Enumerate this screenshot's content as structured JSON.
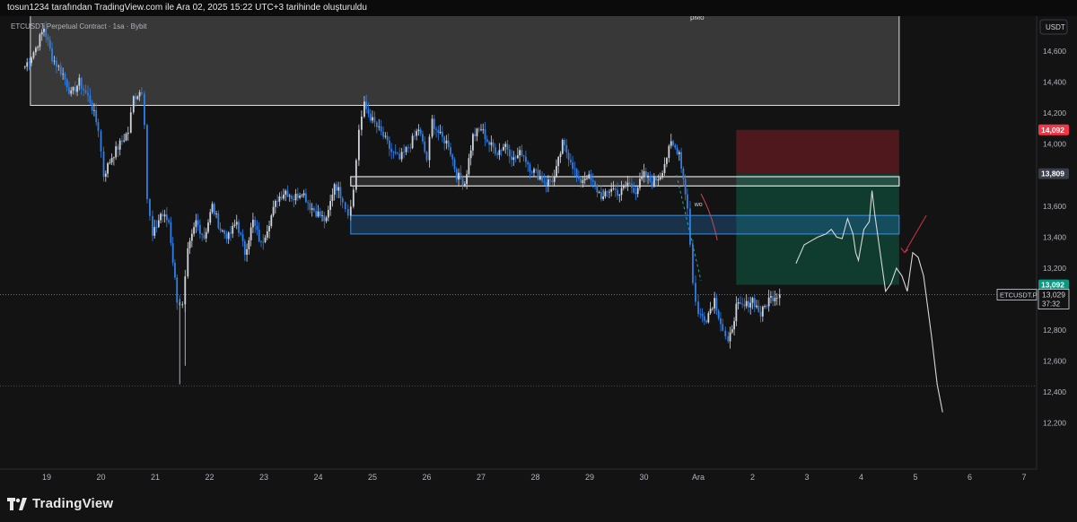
{
  "header": {
    "caption": "tosun1234 tarafından TradingView.com ile Ara 02, 2025 15:22 UTC+3 tarihinde oluşturuldu"
  },
  "footer": {
    "brand": "TradingView"
  },
  "chart_data": {
    "type": "candlestick",
    "symbol_line": "ETCUSDT Perpetual Contract · 1sa · Bybit",
    "currency": "USDT",
    "top_label": "pMo",
    "ylim": [
      12100,
      14870
    ],
    "y_ticks": [
      "14,600",
      "14,400",
      "14,200",
      "14,000",
      "13,800",
      "13,600",
      "13,400",
      "13,200",
      "12,800",
      "12,600",
      "12,400",
      "12,200"
    ],
    "x_ticks": [
      "19",
      "20",
      "21",
      "22",
      "23",
      "24",
      "25",
      "26",
      "27",
      "28",
      "29",
      "30",
      "Ara",
      "2",
      "3",
      "4",
      "5",
      "6",
      "7"
    ],
    "price_badges": [
      {
        "text": "14,092",
        "value": 14092,
        "color": "#f23645"
      },
      {
        "text": "13,809",
        "value": 13809,
        "color": "#3a3e4a"
      },
      {
        "text": "13,092",
        "value": 13092,
        "color": "#089981"
      }
    ],
    "last_price": {
      "symbol": "ETCUSDT.P",
      "price": "13,029",
      "countdown": "37:32",
      "value": 13029
    },
    "annotations": {
      "wo_label": "wo"
    },
    "colors": {
      "up": "#cfd3dc",
      "down": "#2f7fe6",
      "background": "#131313"
    },
    "zones": [
      {
        "name": "supply-zone",
        "x_from": "18.7",
        "x_to": "Ara 3.7",
        "y_low": 14250,
        "y_high": 14830
      },
      {
        "name": "stop-zone",
        "x_from": "Ara 0.7",
        "x_to": "Ara 3.7",
        "y_low": 13809,
        "y_high": 14092
      },
      {
        "name": "target-zone",
        "x_from": "Ara 0.7",
        "x_to": "Ara 3.7",
        "y_low": 13092,
        "y_high": 13809
      },
      {
        "name": "demand-zone",
        "x_from": "24.6",
        "x_to": "Ara 3.7",
        "y_low": 13420,
        "y_high": 13540
      },
      {
        "name": "level-box",
        "x_from": "24.6",
        "x_to": "Ara 3.7",
        "y_low": 13730,
        "y_high": 13790
      }
    ],
    "candle_path": [
      [
        18.6,
        14500
      ],
      [
        18.8,
        14620
      ],
      [
        18.95,
        14750
      ],
      [
        19.1,
        14560
      ],
      [
        19.3,
        14450
      ],
      [
        19.45,
        14320
      ],
      [
        19.6,
        14400
      ],
      [
        19.8,
        14280
      ],
      [
        19.95,
        14100
      ],
      [
        20.05,
        13800
      ],
      [
        20.2,
        13920
      ],
      [
        20.35,
        14000
      ],
      [
        20.5,
        14080
      ],
      [
        20.6,
        14300
      ],
      [
        20.75,
        14350
      ],
      [
        20.8,
        14150
      ],
      [
        20.85,
        13650
      ],
      [
        20.95,
        13400
      ],
      [
        21.1,
        13550
      ],
      [
        21.25,
        13500
      ],
      [
        21.4,
        13000
      ],
      [
        21.5,
        12950
      ],
      [
        21.6,
        13300
      ],
      [
        21.75,
        13500
      ],
      [
        21.9,
        13400
      ],
      [
        22.05,
        13600
      ],
      [
        22.2,
        13450
      ],
      [
        22.35,
        13400
      ],
      [
        22.5,
        13500
      ],
      [
        22.65,
        13300
      ],
      [
        22.8,
        13500
      ],
      [
        22.95,
        13350
      ],
      [
        23.1,
        13500
      ],
      [
        23.25,
        13650
      ],
      [
        23.4,
        13700
      ],
      [
        23.55,
        13650
      ],
      [
        23.7,
        13700
      ],
      [
        23.85,
        13600
      ],
      [
        24.0,
        13550
      ],
      [
        24.15,
        13500
      ],
      [
        24.3,
        13750
      ],
      [
        24.45,
        13650
      ],
      [
        24.55,
        13550
      ],
      [
        24.65,
        13700
      ],
      [
        24.75,
        14100
      ],
      [
        24.85,
        14250
      ],
      [
        25.0,
        14150
      ],
      [
        25.2,
        14050
      ],
      [
        25.35,
        13950
      ],
      [
        25.5,
        13900
      ],
      [
        25.7,
        14000
      ],
      [
        25.85,
        14100
      ],
      [
        26.0,
        13900
      ],
      [
        26.1,
        14150
      ],
      [
        26.25,
        14050
      ],
      [
        26.4,
        14000
      ],
      [
        26.55,
        13800
      ],
      [
        26.7,
        13750
      ],
      [
        26.85,
        14050
      ],
      [
        27.0,
        14100
      ],
      [
        27.15,
        14000
      ],
      [
        27.3,
        13950
      ],
      [
        27.45,
        14000
      ],
      [
        27.6,
        13900
      ],
      [
        27.75,
        13950
      ],
      [
        27.9,
        13850
      ],
      [
        28.05,
        13800
      ],
      [
        28.2,
        13750
      ],
      [
        28.35,
        13780
      ],
      [
        28.5,
        14000
      ],
      [
        28.65,
        13900
      ],
      [
        28.8,
        13750
      ],
      [
        28.95,
        13800
      ],
      [
        29.1,
        13720
      ],
      [
        29.25,
        13650
      ],
      [
        29.4,
        13720
      ],
      [
        29.55,
        13680
      ],
      [
        29.7,
        13750
      ],
      [
        29.85,
        13700
      ],
      [
        30.0,
        13800
      ],
      [
        30.15,
        13750
      ],
      [
        30.3,
        13800
      ],
      [
        30.5,
        14000
      ],
      [
        30.65,
        13950
      ],
      [
        30.8,
        13600
      ],
      [
        30.9,
        13100
      ],
      [
        31.0,
        12900
      ],
      [
        31.15,
        12880
      ],
      [
        31.3,
        13000
      ],
      [
        31.45,
        12800
      ],
      [
        31.55,
        12700
      ],
      [
        31.7,
        12950
      ],
      [
        31.85,
        12950
      ],
      [
        32.0,
        13000
      ],
      [
        32.15,
        12900
      ],
      [
        32.3,
        13000
      ],
      [
        32.45,
        13030
      ],
      [
        32.55,
        13050
      ]
    ],
    "projection_path": [
      [
        32.8,
        13230
      ],
      [
        32.95,
        13350
      ],
      [
        33.1,
        13380
      ],
      [
        33.2,
        13400
      ],
      [
        33.35,
        13420
      ],
      [
        33.45,
        13450
      ],
      [
        33.55,
        13400
      ],
      [
        33.65,
        13390
      ],
      [
        33.75,
        13520
      ],
      [
        33.85,
        13420
      ],
      [
        33.9,
        13300
      ],
      [
        33.95,
        13250
      ],
      [
        34.05,
        13450
      ],
      [
        34.15,
        13500
      ],
      [
        34.2,
        13700
      ],
      [
        34.25,
        13550
      ],
      [
        34.35,
        13300
      ],
      [
        34.45,
        13050
      ],
      [
        34.55,
        13100
      ],
      [
        34.65,
        13200
      ],
      [
        34.75,
        13150
      ],
      [
        34.85,
        13050
      ],
      [
        34.95,
        13300
      ],
      [
        35.05,
        13270
      ],
      [
        35.15,
        13150
      ],
      [
        35.3,
        12750
      ],
      [
        35.4,
        12450
      ],
      [
        35.5,
        12270
      ]
    ]
  }
}
